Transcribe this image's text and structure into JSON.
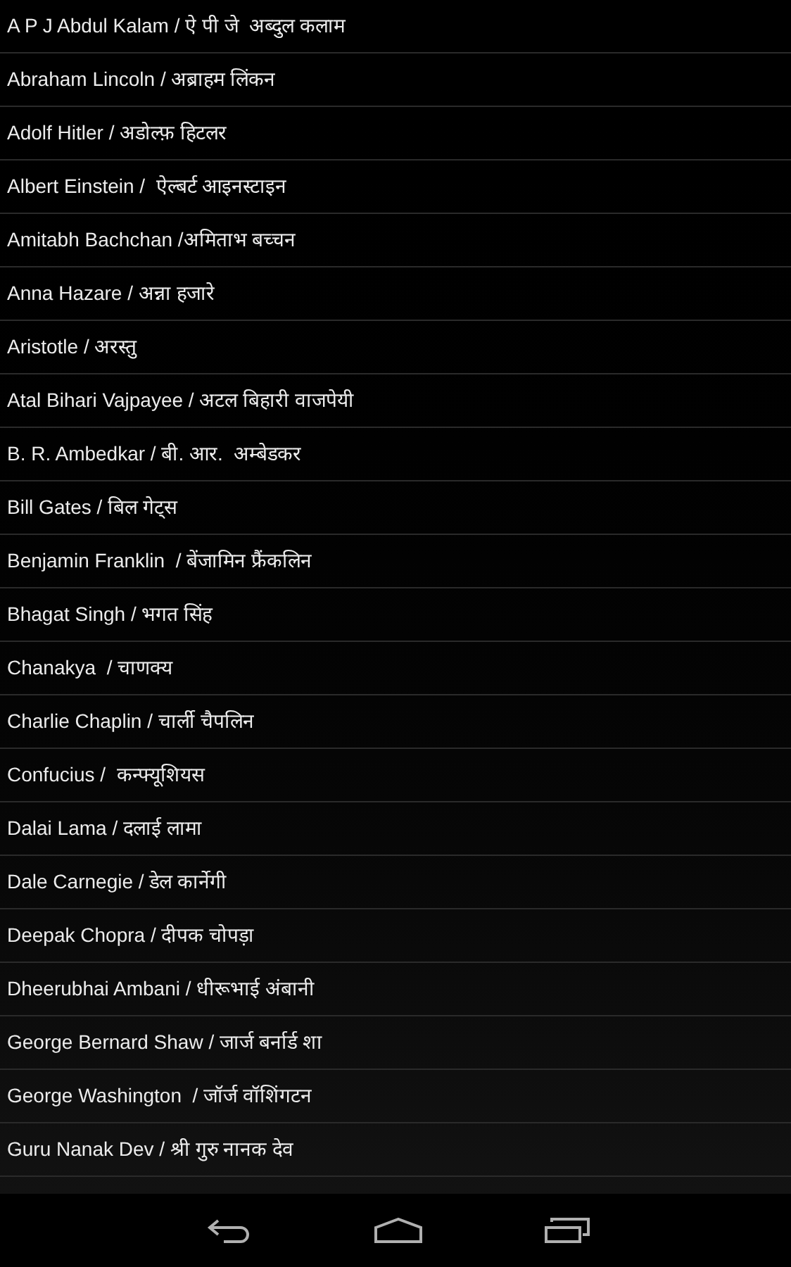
{
  "list": [
    {
      "label": "A P J Abdul Kalam / ऐ पी जे  अब्दुल कलाम"
    },
    {
      "label": "Abraham Lincoln / अब्राहम लिंकन"
    },
    {
      "label": "Adolf Hitler / अडोल्फ़ हिटलर"
    },
    {
      "label": "Albert Einstein /  ऐल्बर्ट आइनस्टाइन"
    },
    {
      "label": "Amitabh Bachchan /अमिताभ बच्चन"
    },
    {
      "label": "Anna Hazare / अन्ना हजारे"
    },
    {
      "label": "Aristotle / अरस्तु"
    },
    {
      "label": "Atal Bihari Vajpayee / अटल बिहारी वाजपेयी"
    },
    {
      "label": "B. R. Ambedkar / बी. आर.  अम्बेडकर"
    },
    {
      "label": "Bill Gates / बिल गेट्स"
    },
    {
      "label": "Benjamin Franklin  / बेंजामिन फ्रैंकलिन"
    },
    {
      "label": "Bhagat Singh / भगत सिंह"
    },
    {
      "label": "Chanakya  / चाणक्य"
    },
    {
      "label": "Charlie Chaplin / चार्ली चैपलिन"
    },
    {
      "label": "Confucius /  कन्फ्यूशियस"
    },
    {
      "label": "Dalai Lama / दलाई लामा"
    },
    {
      "label": "Dale Carnegie / डेल कार्नेगी"
    },
    {
      "label": "Deepak Chopra / दीपक चोपड़ा"
    },
    {
      "label": "Dheerubhai Ambani / धीरूभाई अंबानी"
    },
    {
      "label": "George Bernard Shaw / जार्ज बर्नार्ड शा"
    },
    {
      "label": "George Washington  / जॉर्ज वॉशिंगटन"
    },
    {
      "label": "Guru Nanak Dev / श्री गुरु नानक देव"
    }
  ]
}
